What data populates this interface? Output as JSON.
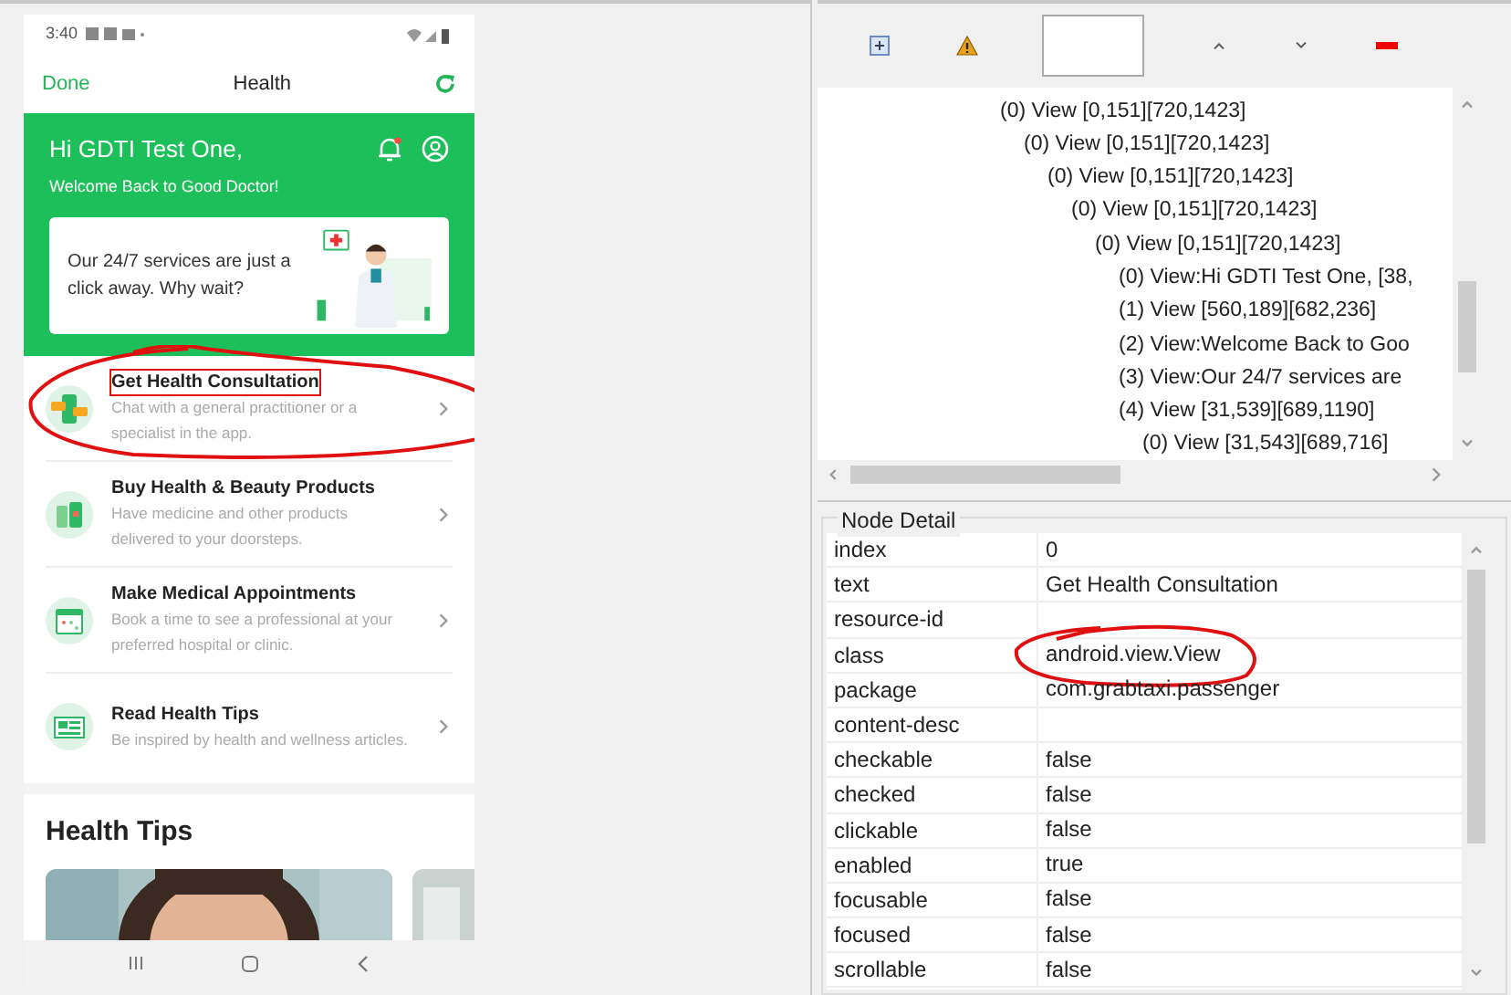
{
  "phone": {
    "status_bar": {
      "time": "3:40"
    },
    "header": {
      "done": "Done",
      "title": "Health"
    },
    "banner": {
      "greeting": "Hi GDTI Test One,",
      "subtitle": "Welcome Back to Good Doctor!",
      "notification_dot": true,
      "promo": "Our 24/7 services are just a click away. Why wait?"
    },
    "services": [
      {
        "title": "Get Health Consultation",
        "description": "Chat with a general practitioner or a specialist in the app.",
        "selected": true,
        "circled": true
      },
      {
        "title": "Buy Health & Beauty Products",
        "description": "Have medicine and other products delivered to your doorsteps.",
        "selected": false,
        "circled": false
      },
      {
        "title": "Make Medical Appointments",
        "description": "Book a time to see a professional at your preferred hospital or clinic.",
        "selected": false,
        "circled": false
      },
      {
        "title": "Read Health Tips",
        "description": "Be inspired by health and wellness articles.",
        "selected": false,
        "circled": false
      }
    ],
    "health_tips": {
      "title": "Health Tips"
    }
  },
  "tree": [
    {
      "label": "(0) View [0,151][720,1423]",
      "children": [
        {
          "label": "(0) View [0,151][720,1423]",
          "children": [
            {
              "label": "(0) View [0,151][720,1423]",
              "children": [
                {
                  "label": "(0) View [0,151][720,1423]",
                  "children": [
                    {
                      "label": "(0) View [0,151][720,1423]",
                      "children": [
                        {
                          "label": "(0) View:Hi GDTI Test One, [38,"
                        },
                        {
                          "label": "(1) View [560,189][682,236]"
                        },
                        {
                          "label": "(2) View:Welcome Back to Goo"
                        },
                        {
                          "label": "(3) View:Our 24/7 services are"
                        },
                        {
                          "label": "(4) View [31,539][689,1190]",
                          "children": [
                            {
                              "label": "(0) View [31,543][689,716]"
                            }
                          ]
                        }
                      ]
                    }
                  ]
                }
              ]
            }
          ]
        }
      ]
    }
  ],
  "node_detail": {
    "title": "Node Detail",
    "rows": [
      {
        "key": "index",
        "value": "0",
        "circled": false
      },
      {
        "key": "text",
        "value": "Get Health Consultation",
        "circled": false
      },
      {
        "key": "resource-id",
        "circled": false
      },
      {
        "key": "class",
        "value": "android.view.View",
        "circled": true
      },
      {
        "key": "package",
        "value": "com.grabtaxi.passenger",
        "circled": false
      },
      {
        "key": "content-desc",
        "circled": false
      },
      {
        "key": "checkable",
        "value": "false",
        "circled": false
      },
      {
        "key": "checked",
        "value": "false",
        "circled": false
      },
      {
        "key": "clickable",
        "value": "false",
        "circled": false
      },
      {
        "key": "enabled",
        "value": "true",
        "circled": false
      },
      {
        "key": "focusable",
        "value": "false",
        "circled": false
      },
      {
        "key": "focused",
        "value": "false",
        "circled": false
      },
      {
        "key": "scrollable",
        "value": "false",
        "circled": false
      }
    ]
  }
}
